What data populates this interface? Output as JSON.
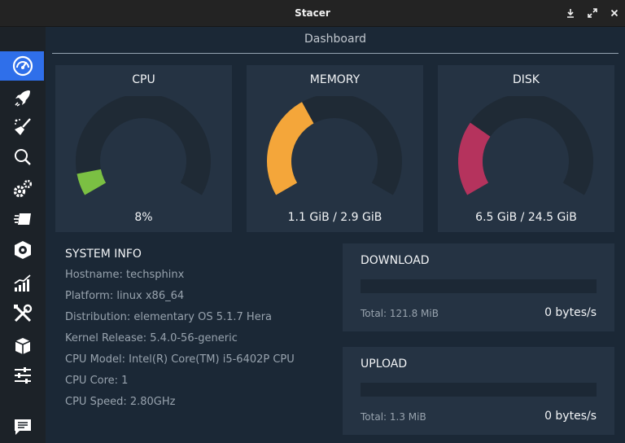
{
  "window": {
    "title": "Stacer"
  },
  "sidebar": {
    "items": [
      {
        "name": "dashboard",
        "icon": "speedometer-icon",
        "active": true
      },
      {
        "name": "startup-apps",
        "icon": "rocket-icon"
      },
      {
        "name": "system-cleaner",
        "icon": "broom-icon"
      },
      {
        "name": "search",
        "icon": "search-icon"
      },
      {
        "name": "services",
        "icon": "gears-icon"
      },
      {
        "name": "processes",
        "icon": "processes-icon"
      },
      {
        "name": "uninstaller",
        "icon": "package-icon"
      },
      {
        "name": "resources",
        "icon": "chart-icon"
      },
      {
        "name": "helpers",
        "icon": "tools-icon"
      },
      {
        "name": "apt-repository",
        "icon": "box-icon"
      },
      {
        "name": "settings",
        "icon": "sliders-icon"
      },
      {
        "name": "feedback",
        "icon": "chat-icon"
      }
    ]
  },
  "dashboard": {
    "title": "Dashboard",
    "gauges": [
      {
        "title": "CPU",
        "value": "8%",
        "percent": 8,
        "color": "#7bc043"
      },
      {
        "title": "MEMORY",
        "value": "1.1 GiB / 2.9 GiB",
        "percent": 38,
        "color": "#f4a63a"
      },
      {
        "title": "DISK",
        "value": "6.5 GiB / 24.5 GiB",
        "percent": 27,
        "color": "#b5335d"
      }
    ],
    "track_color": "#1f2a35"
  },
  "system_info": {
    "heading": "SYSTEM INFO",
    "rows": [
      "Hostname: techsphinx",
      "Platform: linux x86_64",
      "Distribution: elementary OS 5.1.7 Hera",
      "Kernel Release: 5.4.0-56-generic",
      "CPU Model: Intel(R) Core(TM) i5-6402P CPU",
      "CPU Core: 1",
      "CPU Speed: 2.80GHz"
    ]
  },
  "network": {
    "download": {
      "title": "DOWNLOAD",
      "total": "Total: 121.8 MiB",
      "rate": "0 bytes/s",
      "percent": 0
    },
    "upload": {
      "title": "UPLOAD",
      "total": "Total: 1.3 MiB",
      "rate": "0 bytes/s",
      "percent": 0
    }
  }
}
